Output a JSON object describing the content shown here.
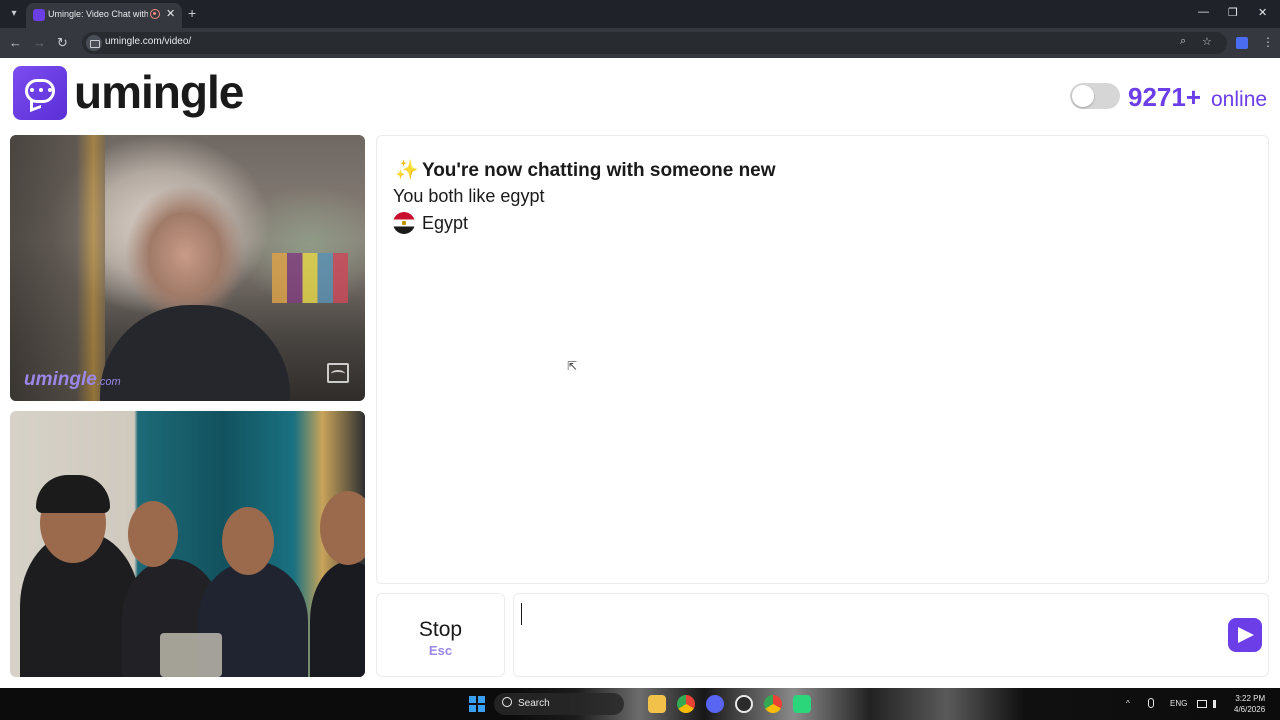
{
  "browser": {
    "tab_title": "Umingle: Video Chat with S",
    "tab_close": "✕",
    "new_tab": "+",
    "url": "umingle.com/video/",
    "window_controls": {
      "minimize": "—",
      "restore": "❐",
      "close": "✕"
    },
    "nav": {
      "back": "←",
      "forward": "→",
      "reload": "↻"
    },
    "icons": {
      "zoom": "⌕",
      "star": "☆",
      "menu": "⋮"
    }
  },
  "header": {
    "logo_text": "umingle",
    "online_count": "9271+",
    "online_label": "online",
    "toggle_on": false
  },
  "videos": {
    "stranger_watermark": "umingle",
    "stranger_watermark_suffix": ".com"
  },
  "chat": {
    "sparkle": "✨",
    "status": "You're now chatting with someone new",
    "common_interest": "You both like egypt",
    "country": "Egypt"
  },
  "controls": {
    "stop_label": "Stop",
    "stop_key": "Esc",
    "message_value": ""
  },
  "taskbar": {
    "search_label": "Search",
    "language": "ENG",
    "time": "3:22 PM",
    "date": "4/6/2026"
  },
  "colors": {
    "accent": "#6c3ee8",
    "accent_light": "#9b87e8"
  }
}
